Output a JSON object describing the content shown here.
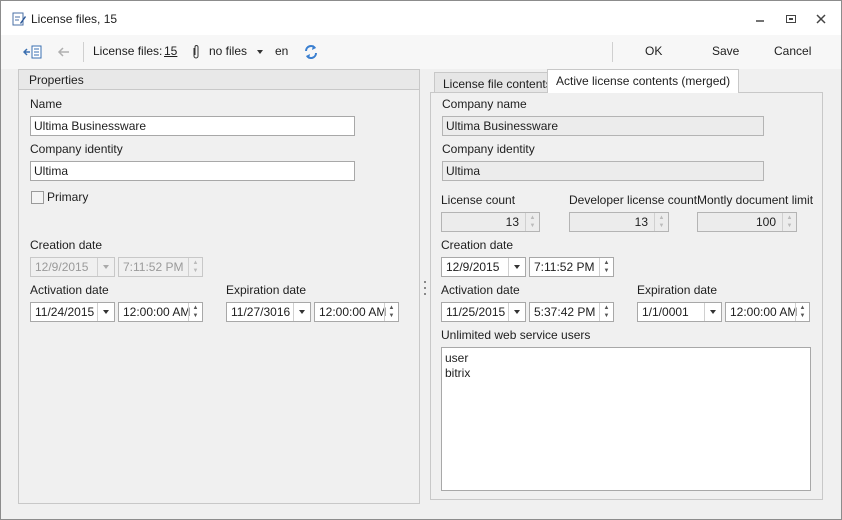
{
  "window": {
    "title": "License files, 15"
  },
  "toolbar": {
    "license_files_label": "License files:",
    "license_files_count": "15",
    "attachment_text": "no files",
    "language": "en",
    "ok_label": "OK",
    "save_label": "Save",
    "cancel_label": "Cancel"
  },
  "properties": {
    "header": "Properties",
    "name_label": "Name",
    "name_value": "Ultima Businessware",
    "company_identity_label": "Company identity",
    "company_identity_value": "Ultima",
    "primary_label": "Primary",
    "creation_date_label": "Creation date",
    "creation_date": "12/9/2015",
    "creation_time": "7:11:52 PM",
    "activation_date_label": "Activation date",
    "activation_date": "11/24/2015",
    "activation_time": "12:00:00 AM",
    "expiration_date_label": "Expiration date",
    "expiration_date": "11/27/3016",
    "expiration_time": "12:00:00 AM"
  },
  "tabs": [
    {
      "label": "License file contents"
    },
    {
      "label": "Active license contents (merged)"
    }
  ],
  "active_license": {
    "company_name_label": "Company name",
    "company_name_value": "Ultima Businessware",
    "company_identity_label": "Company identity",
    "company_identity_value": "Ultima",
    "license_count_label": "License count",
    "license_count_value": "13",
    "developer_license_count_label": "Developer license count",
    "developer_license_count_value": "13",
    "monthly_document_limit_label": "Montly document limit",
    "monthly_document_limit_value": "100",
    "creation_date_label": "Creation date",
    "creation_date": "12/9/2015",
    "creation_time": "7:11:52 PM",
    "activation_date_label": "Activation date",
    "activation_date": "11/25/2015",
    "activation_time": "5:37:42 PM",
    "expiration_date_label": "Expiration date",
    "expiration_date": "1/1/0001",
    "expiration_time": "12:00:00 AM",
    "unlimited_users_label": "Unlimited web service users",
    "unlimited_users": [
      "user",
      "bitrix"
    ]
  }
}
